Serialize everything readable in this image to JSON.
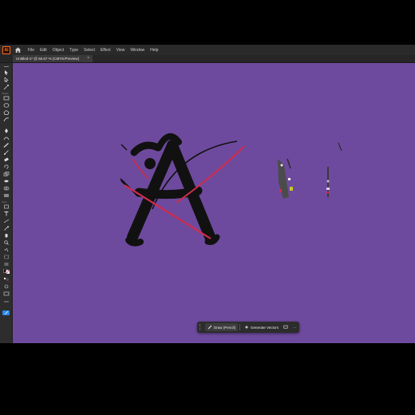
{
  "app": {
    "logo_text": "Ai"
  },
  "menu": {
    "items": [
      "File",
      "Edit",
      "Object",
      "Type",
      "Select",
      "Effect",
      "View",
      "Window",
      "Help"
    ]
  },
  "document_tab": {
    "title": "Untitled-1* @ 66.67 % (CMYK/Preview)",
    "close_glyph": "×"
  },
  "toolbar": {
    "section_labels": {
      "shape": "Shape",
      "type": "Type"
    }
  },
  "canvas": {
    "background": "#6e4a9e",
    "stroke_color": "#111111",
    "accent_stroke_color": "#d02c4c"
  },
  "floating_bar": {
    "draw_label": "Draw (Pencil)",
    "generate_label": "Generate Vectors",
    "more_glyph": "···"
  },
  "colors": {
    "app_bg": "#323232",
    "menubar_bg": "#2a2a2a",
    "brand": "#ff7c00"
  }
}
